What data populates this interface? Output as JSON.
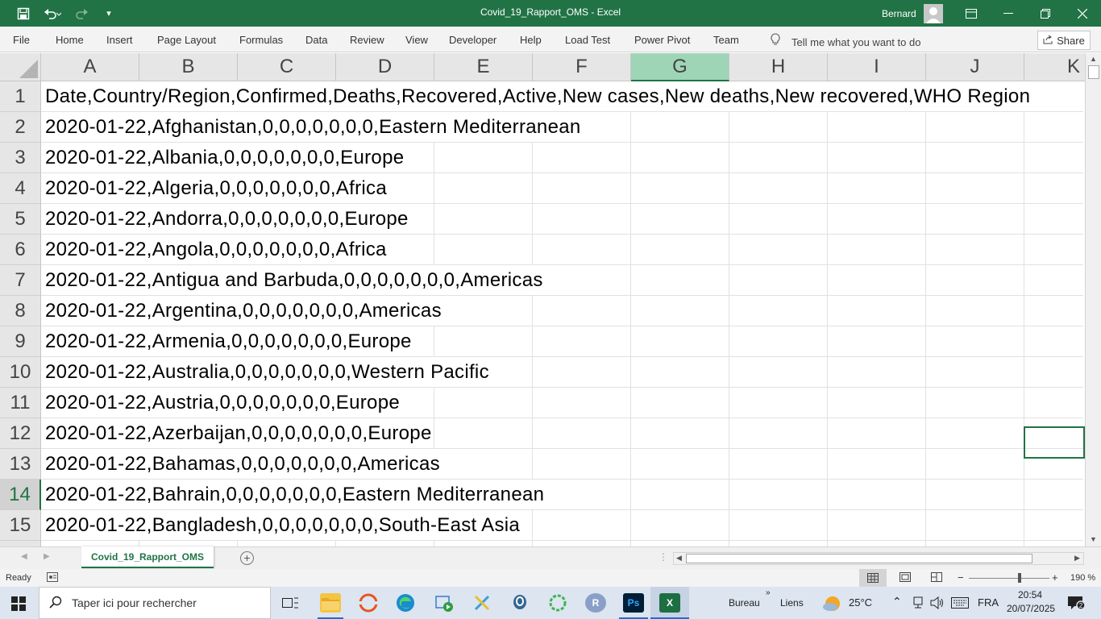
{
  "window": {
    "title": "Covid_19_Rapport_OMS  -  Excel",
    "user": "Bernard"
  },
  "ribbon_tabs": [
    "File",
    "Home",
    "Insert",
    "Page Layout",
    "Formulas",
    "Data",
    "Review",
    "View",
    "Developer",
    "Help",
    "Load Test",
    "Power Pivot",
    "Team"
  ],
  "tell_me": "Tell me what you want to do",
  "share_label": "Share",
  "columns": [
    "A",
    "B",
    "C",
    "D",
    "E",
    "F",
    "G",
    "H",
    "I",
    "J",
    "K"
  ],
  "selected_column": "G",
  "rows": [
    {
      "num": "1",
      "text": "Date,Country/Region,Confirmed,Deaths,Recovered,Active,New cases,New deaths,New recovered,WHO Region"
    },
    {
      "num": "2",
      "text": "2020-01-22,Afghanistan,0,0,0,0,0,0,0,Eastern Mediterranean"
    },
    {
      "num": "3",
      "text": "2020-01-22,Albania,0,0,0,0,0,0,0,Europe"
    },
    {
      "num": "4",
      "text": "2020-01-22,Algeria,0,0,0,0,0,0,0,Africa"
    },
    {
      "num": "5",
      "text": "2020-01-22,Andorra,0,0,0,0,0,0,0,Europe"
    },
    {
      "num": "6",
      "text": "2020-01-22,Angola,0,0,0,0,0,0,0,Africa"
    },
    {
      "num": "7",
      "text": "2020-01-22,Antigua and Barbuda,0,0,0,0,0,0,0,Americas"
    },
    {
      "num": "8",
      "text": "2020-01-22,Argentina,0,0,0,0,0,0,0,Americas"
    },
    {
      "num": "9",
      "text": "2020-01-22,Armenia,0,0,0,0,0,0,0,Europe"
    },
    {
      "num": "10",
      "text": "2020-01-22,Australia,0,0,0,0,0,0,0,Western Pacific"
    },
    {
      "num": "11",
      "text": "2020-01-22,Austria,0,0,0,0,0,0,0,Europe"
    },
    {
      "num": "12",
      "text": "2020-01-22,Azerbaijan,0,0,0,0,0,0,0,Europe"
    },
    {
      "num": "13",
      "text": "2020-01-22,Bahamas,0,0,0,0,0,0,0,Americas"
    },
    {
      "num": "14",
      "text": "2020-01-22,Bahrain,0,0,0,0,0,0,0,Eastern Mediterranean"
    },
    {
      "num": "15",
      "text": "2020-01-22,Bangladesh,0,0,0,0,0,0,0,South-East Asia"
    }
  ],
  "active_cell": "K14",
  "sheet_tab": "Covid_19_Rapport_OMS",
  "status": {
    "ready": "Ready",
    "zoom": "190 %"
  },
  "taskbar": {
    "search_placeholder": "Taper ici pour rechercher",
    "bureau": "Bureau",
    "liens": "Liens",
    "temperature": "25°C",
    "language": "FRA",
    "time": "20:54",
    "date": "20/07/2025"
  },
  "colors": {
    "excel_green": "#217346",
    "selected_header": "#9fd5b7",
    "taskbar": "#dce5f0"
  }
}
